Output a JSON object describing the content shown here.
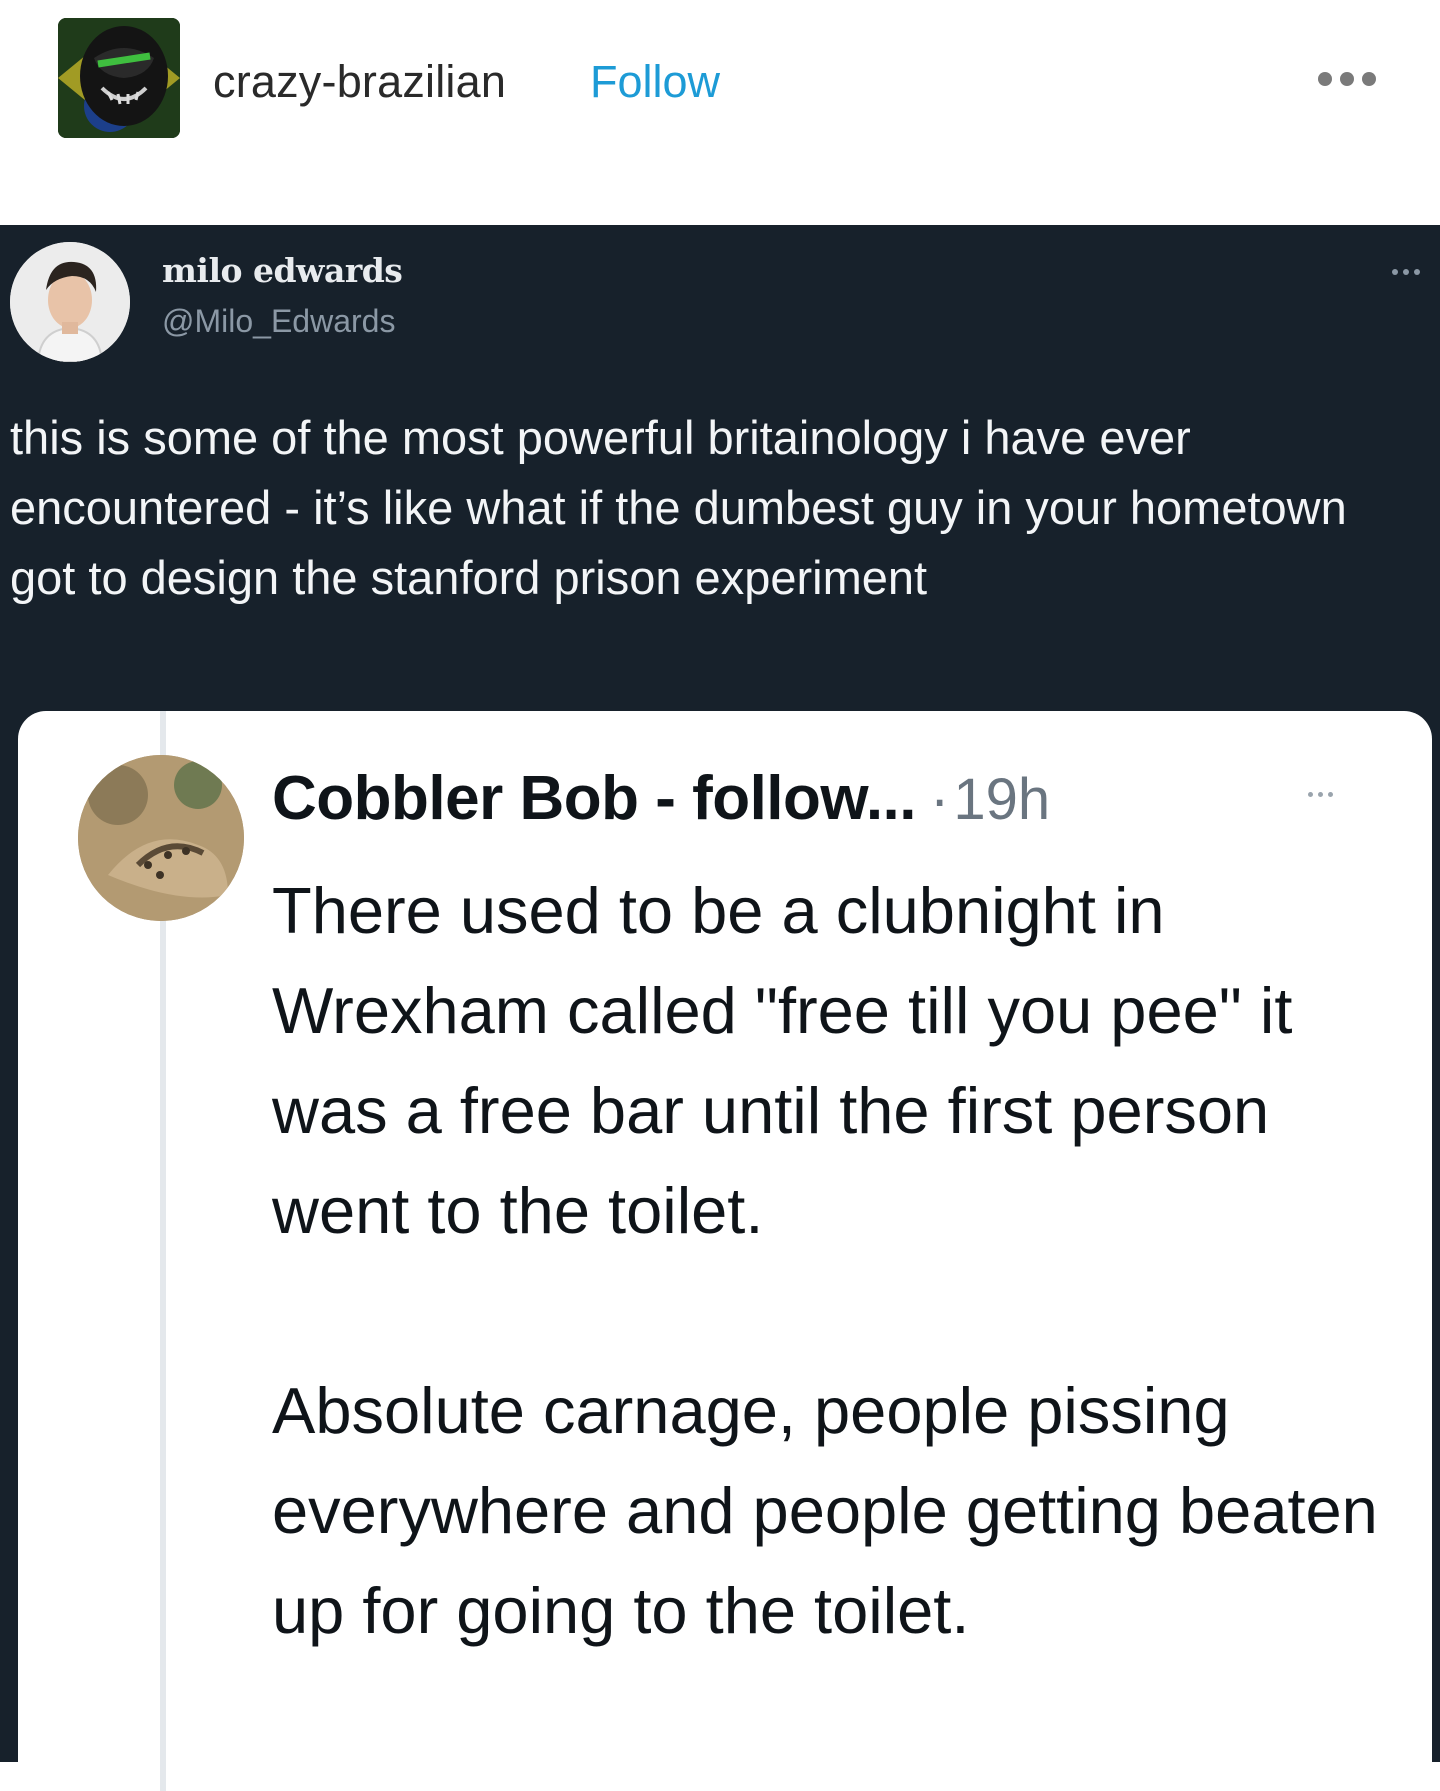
{
  "post": {
    "blog_name": "crazy-brazilian",
    "follow_label": "Follow",
    "more_icon": "ellipsis-icon"
  },
  "tweet": {
    "author_name": "milo edwards",
    "author_handle": "@Milo_Edwards",
    "text": "this is some of the most powerful britainology i have ever encountered - it’s like what if the dumbest guy in your hometown got to design the stanford prison experiment"
  },
  "quoted_tweet": {
    "author_name": "Cobbler Bob - follow...",
    "separator": "·",
    "time": "19h",
    "paragraphs": [
      "There used to be a clubnight in Wrexham called \"free till you pee\" it was a free bar until the first person went to the toilet.",
      "Absolute carnage, people pissing everywhere and people getting beaten up for going to the toilet."
    ]
  },
  "colors": {
    "follow": "#1d9bd6",
    "tweet_background": "#17212b",
    "quote_background": "#ffffff"
  }
}
